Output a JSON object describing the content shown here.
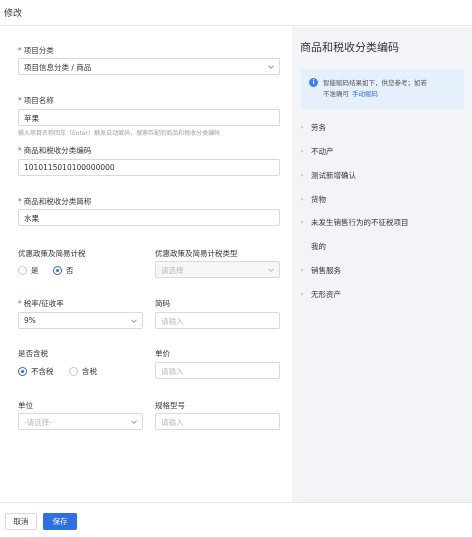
{
  "header": {
    "title": "修改"
  },
  "form": {
    "project_category": {
      "label": "项目分类",
      "value": "项目信息分类 / 商品"
    },
    "project_name": {
      "label": "项目名称",
      "value": "苹果",
      "hint": "输入项目名称回车（Enter）触发自动赋码，搜索匹配的商品和税收分类编码"
    },
    "tax_code": {
      "label": "商品和税收分类编码",
      "value": "1010115010100000000"
    },
    "tax_short_name": {
      "label": "商品和税收分类简称",
      "value": "水果"
    },
    "preferential_policy": {
      "label": "优惠政策及简易计税",
      "options": [
        "是",
        "否"
      ],
      "selected": "否"
    },
    "preferential_type": {
      "label": "优惠政策及简易计税类型",
      "placeholder": "请选择"
    },
    "tax_rate": {
      "label": "税率/征收率",
      "value": "9%"
    },
    "short_code": {
      "label": "简码",
      "placeholder": "请输入"
    },
    "tax_included": {
      "label": "是否含税",
      "options": [
        "不含税",
        "含税"
      ],
      "selected": "不含税"
    },
    "unit_price": {
      "label": "单价",
      "placeholder": "请输入"
    },
    "unit": {
      "label": "单位",
      "placeholder": "-请选择-"
    },
    "spec_model": {
      "label": "规格型号",
      "placeholder": "请输入"
    }
  },
  "panel": {
    "title": "商品和税收分类编码",
    "info_line1": "智能赋码结果如下，供您参考；如若",
    "info_line2": "不准确可",
    "info_link": "手动赋码",
    "tree": [
      {
        "label": "劳务",
        "arrow": true
      },
      {
        "label": "不动产",
        "arrow": true
      },
      {
        "label": "测试新增确认",
        "arrow": true
      },
      {
        "label": "货物",
        "arrow": true
      },
      {
        "label": "未发生销售行为的不征税项目",
        "arrow": true
      },
      {
        "label": "我的",
        "arrow": false
      },
      {
        "label": "销售服务",
        "arrow": true
      },
      {
        "label": "无形资产",
        "arrow": true
      }
    ]
  },
  "footer": {
    "cancel_label": "取消",
    "save_label": "保存"
  },
  "colors": {
    "primary": "#2f6fe4",
    "required": "#e53935",
    "panel_bg": "#f2f4f7",
    "info_bg": "#e6f0fc"
  }
}
